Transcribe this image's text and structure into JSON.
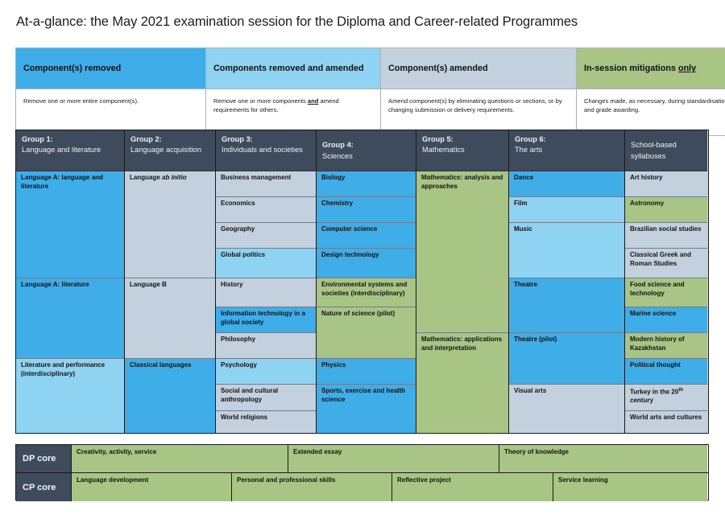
{
  "title": "At-a-glance: the May 2021 examination session for the Diploma and Career-related Programmes",
  "colors": {
    "blue": "#3fade8",
    "light_blue": "#8fd3f2",
    "grey_blue": "#c3d0de",
    "green": "#a8c585",
    "header_navy": "#3e4b5c"
  },
  "legend": {
    "columns": [
      {
        "heading": "Component(s) removed",
        "heading_color": "#3fade8",
        "body": "Remove one or more entire component(s)."
      },
      {
        "heading": "Components removed and amended",
        "heading_color": "#8fd3f2",
        "body_parts": [
          "Remove one or more components ",
          "and",
          " amend requirements for others."
        ],
        "body_bold_word": "and"
      },
      {
        "heading": "Component(s) amended",
        "heading_color": "#c3d0de",
        "body": "Amend component(s) by eliminating questions or sections, or by changing submission or delivery requirements."
      },
      {
        "heading_parts": [
          "In-session mitigations ",
          "only"
        ],
        "heading_underlined_word": "only",
        "heading_color": "#a8c585",
        "body": "Changes made, as necessary, during standardisation, marking, and grade awarding."
      }
    ]
  },
  "groups": [
    {
      "header_title": "Group 1:",
      "header_sub": "Language and literature",
      "subjects": [
        {
          "label": "Language A: language and literature",
          "color": "blue"
        },
        {
          "label": "Language A: literature",
          "color": "blue"
        },
        {
          "label": "Literature and performance (interdisciplinary)",
          "color": "light_blue"
        }
      ]
    },
    {
      "header_title": "Group 2:",
      "header_sub": "Language acquisition",
      "subjects": [
        {
          "label": "Language ab initio",
          "label_italic": "ab initio",
          "color": "grey_blue"
        },
        {
          "label": "Language B",
          "color": "grey_blue"
        },
        {
          "label": "Classical languages",
          "color": "blue"
        }
      ]
    },
    {
      "header_title": "Group 3:",
      "header_sub": "Individuals and societies",
      "subjects": [
        {
          "label": "Business management",
          "color": "grey_blue"
        },
        {
          "label": "Economics",
          "color": "grey_blue"
        },
        {
          "label": "Geography",
          "color": "grey_blue"
        },
        {
          "label": "Global politics",
          "color": "light_blue"
        },
        {
          "label": "History",
          "color": "grey_blue"
        },
        {
          "label": "Information technology in a global society",
          "color": "blue"
        },
        {
          "label": "Philosophy",
          "color": "grey_blue"
        },
        {
          "label": "Psychology",
          "color": "light_blue"
        },
        {
          "label": "Social and cultural anthropology",
          "color": "grey_blue"
        },
        {
          "label": "World religions",
          "color": "grey_blue"
        }
      ]
    },
    {
      "header_title": "Group 4:",
      "header_sub": "Sciences",
      "subjects": [
        {
          "label": "Biology",
          "color": "blue"
        },
        {
          "label": "Chemistry",
          "color": "blue"
        },
        {
          "label": "Computer science",
          "color": "blue"
        },
        {
          "label": "Design technology",
          "color": "blue"
        },
        {
          "label": "Environmental systems and societies (interdisciplinary)",
          "color": "green"
        },
        {
          "label": "Nature of science (pilot)",
          "color": "green"
        },
        {
          "label": "Physics",
          "color": "blue"
        },
        {
          "label": "Sports, exercise and health science",
          "color": "blue"
        }
      ]
    },
    {
      "header_title": "Group 5:",
      "header_sub": "Mathematics",
      "subjects": [
        {
          "label": "Mathematics: analysis and approaches",
          "color": "green"
        },
        {
          "label": "Mathematics: applications and interpretation",
          "color": "green"
        }
      ]
    },
    {
      "header_title": "Group 6:",
      "header_sub": "The arts",
      "subjects": [
        {
          "label": "Dance",
          "color": "blue"
        },
        {
          "label": "Film",
          "color": "light_blue"
        },
        {
          "label": "Music",
          "color": "light_blue"
        },
        {
          "label": "Theatre",
          "color": "blue"
        },
        {
          "label": "Theatre (pilot)",
          "color": "blue"
        },
        {
          "label": "Visual arts",
          "color": "grey_blue"
        }
      ]
    },
    {
      "header_title": "",
      "header_sub": "School-based syllabuses",
      "subjects": [
        {
          "label": "Art history",
          "color": "grey_blue"
        },
        {
          "label": "Astronomy",
          "color": "green"
        },
        {
          "label": "Brazilian social studies",
          "color": "grey_blue"
        },
        {
          "label": "Classical Greek and Roman Studies",
          "color": "grey_blue"
        },
        {
          "label": "Food science and technology",
          "color": "green"
        },
        {
          "label": "Marine science",
          "color": "blue"
        },
        {
          "label": "Modern history of Kazakhstan",
          "color": "green"
        },
        {
          "label": "Political thought",
          "color": "blue"
        },
        {
          "label": "Turkey in the 20th century",
          "color": "grey_blue",
          "superscript": "th"
        },
        {
          "label": "World arts and cultures",
          "color": "grey_blue"
        }
      ]
    }
  ],
  "core": {
    "rows": [
      {
        "label": "DP core",
        "cells": [
          "Creativity, activity, service",
          "Extended essay",
          "Theory of knowledge"
        ]
      },
      {
        "label": "CP core",
        "cells": [
          "Language development",
          "Personal and professional skills",
          "Reflective project",
          "Service learning"
        ]
      }
    ]
  }
}
